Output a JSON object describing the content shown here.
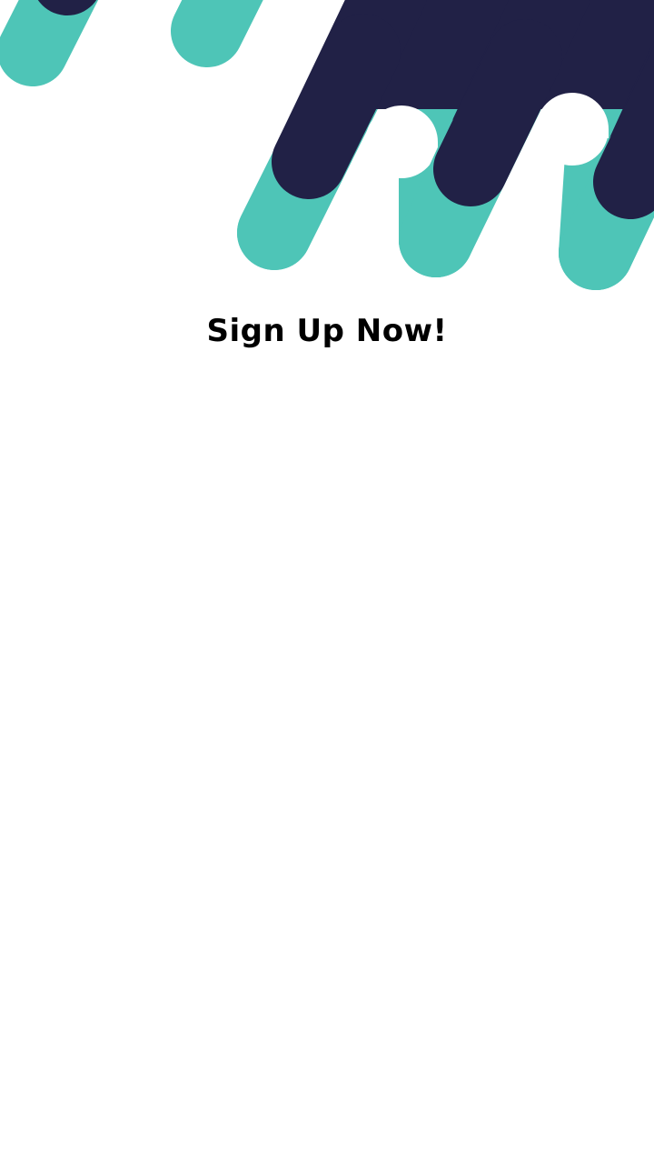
{
  "header": {
    "title": "Sign Up Now!"
  },
  "colors": {
    "teal": "#4EC5B7",
    "navy": "#212146",
    "background": "#FFFFFF",
    "title": "#000000"
  }
}
